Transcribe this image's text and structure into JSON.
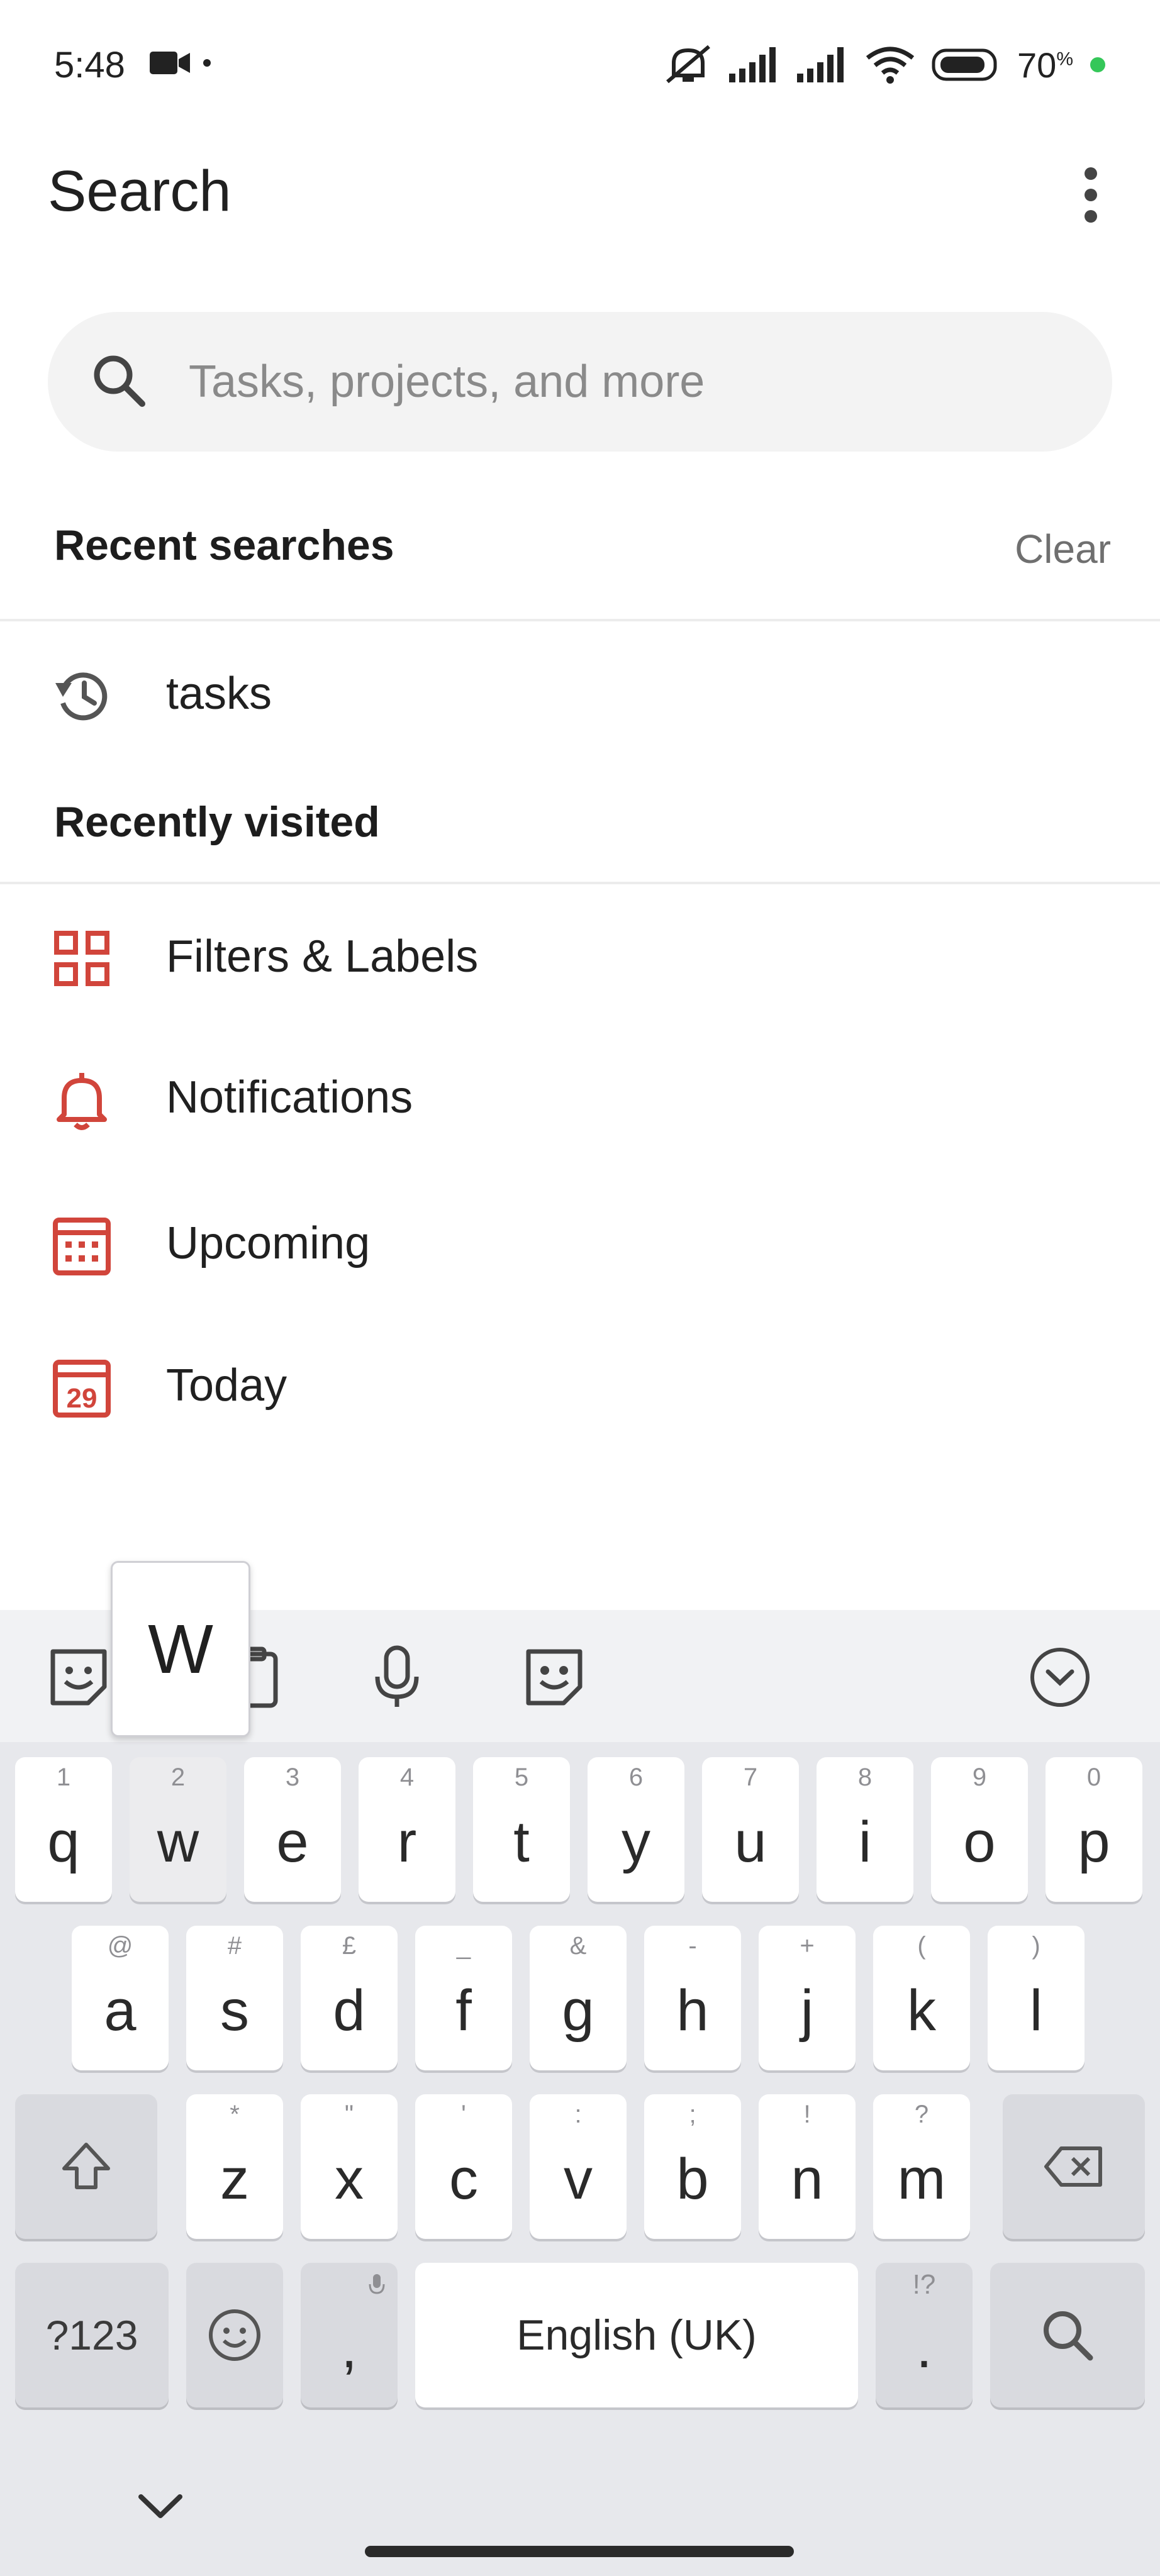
{
  "status_bar": {
    "time": "5:48",
    "battery_level": "70",
    "battery_unit": "%",
    "icons": [
      "video-camera-icon",
      "dot-icon",
      "mute-icon",
      "signal-icon",
      "signal-icon",
      "wifi-icon",
      "battery-icon",
      "charging-dot-icon"
    ]
  },
  "header": {
    "title": "Search",
    "more_icon": "more-vertical-icon"
  },
  "search": {
    "placeholder": "Tasks, projects, and more",
    "value": ""
  },
  "recent_searches": {
    "title": "Recent searches",
    "clear_label": "Clear",
    "items": [
      {
        "label": "tasks",
        "icon": "history-icon"
      }
    ]
  },
  "recently_visited": {
    "title": "Recently visited",
    "items": [
      {
        "label": "Filters & Labels",
        "icon": "grid-icon"
      },
      {
        "label": "Notifications",
        "icon": "bell-icon"
      },
      {
        "label": "Upcoming",
        "icon": "calendar-grid-icon"
      },
      {
        "label": "Today",
        "icon": "calendar-today-icon",
        "day": "29"
      }
    ]
  },
  "colors": {
    "accent": "#d1453b",
    "text_primary": "#202020",
    "text_secondary": "#8a8a8a",
    "search_bg": "#f3f3f3",
    "keyboard_bg": "#e7e8ec"
  },
  "keyboard": {
    "popup_key": "w",
    "toolbar_icons": [
      "sticker-icon",
      "clipboard-icon",
      "microphone-icon",
      "emoji-face-icon",
      "collapse-chevron-icon"
    ],
    "row1": [
      {
        "hint": "1",
        "key": "q"
      },
      {
        "hint": "2",
        "key": "w"
      },
      {
        "hint": "3",
        "key": "e"
      },
      {
        "hint": "4",
        "key": "r"
      },
      {
        "hint": "5",
        "key": "t"
      },
      {
        "hint": "6",
        "key": "y"
      },
      {
        "hint": "7",
        "key": "u"
      },
      {
        "hint": "8",
        "key": "i"
      },
      {
        "hint": "9",
        "key": "o"
      },
      {
        "hint": "0",
        "key": "p"
      }
    ],
    "row2": [
      {
        "hint": "@",
        "key": "a"
      },
      {
        "hint": "#",
        "key": "s"
      },
      {
        "hint": "£",
        "key": "d"
      },
      {
        "hint": "_",
        "key": "f"
      },
      {
        "hint": "&",
        "key": "g"
      },
      {
        "hint": "-",
        "key": "h"
      },
      {
        "hint": "+",
        "key": "j"
      },
      {
        "hint": "(",
        "key": "k"
      },
      {
        "hint": ")",
        "key": "l"
      }
    ],
    "row3": [
      {
        "hint": "*",
        "key": "z"
      },
      {
        "hint": "\"",
        "key": "x"
      },
      {
        "hint": "'",
        "key": "c"
      },
      {
        "hint": ":",
        "key": "v"
      },
      {
        "hint": ";",
        "key": "b"
      },
      {
        "hint": "!",
        "key": "n"
      },
      {
        "hint": "?",
        "key": "m"
      }
    ],
    "symbols_label": "?123",
    "comma": ",",
    "space_label": "English (UK)",
    "period": ".",
    "period_hint": "!?"
  }
}
